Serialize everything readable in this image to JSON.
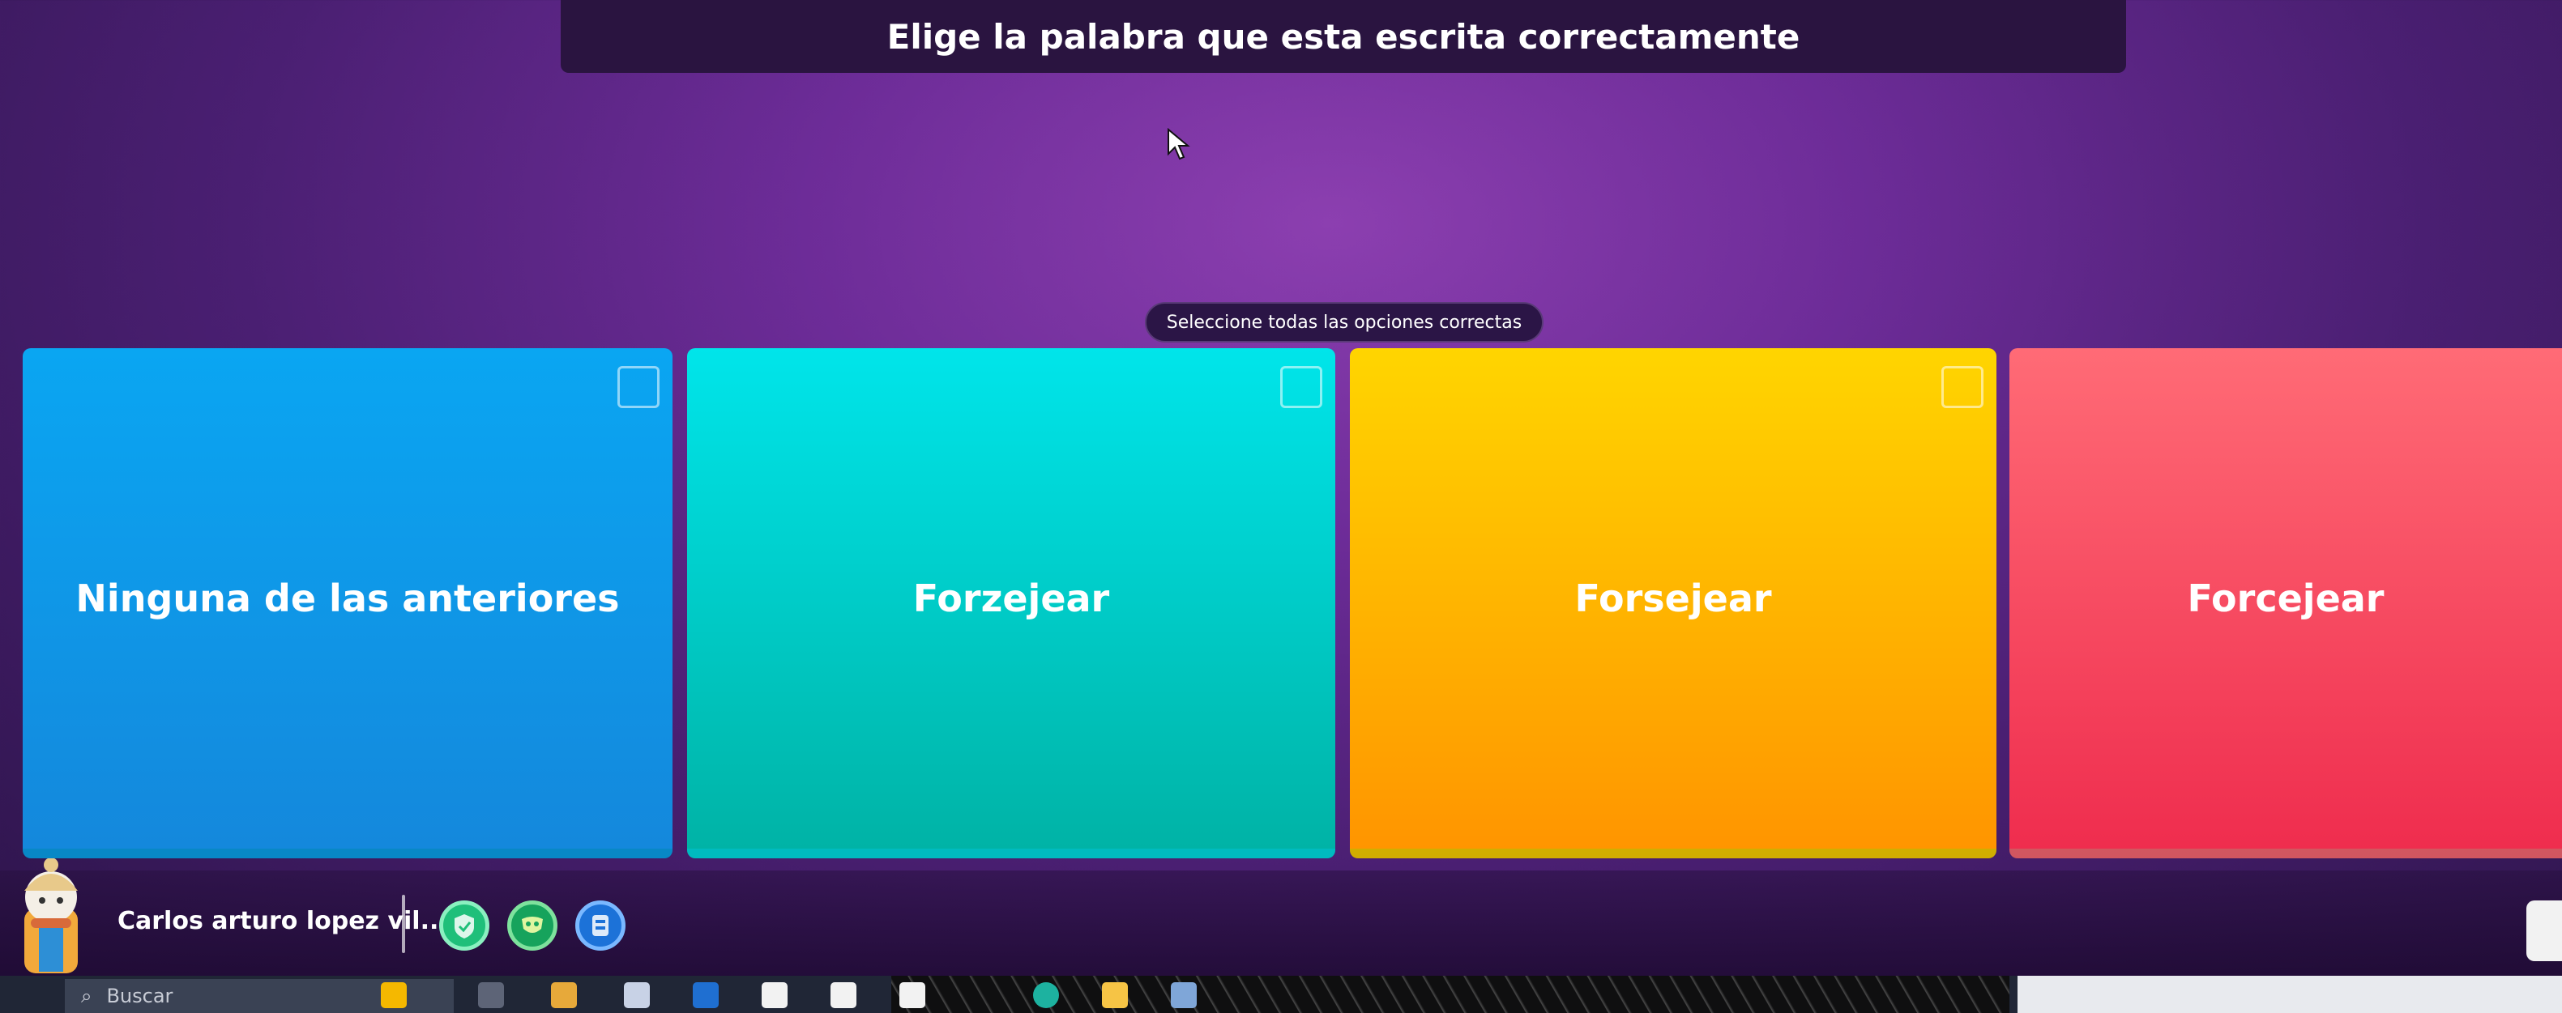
{
  "question": {
    "text": "Elige la palabra que esta escrita correctamente"
  },
  "instruction": {
    "text": "Seleccione todas las opciones correctas"
  },
  "options": [
    {
      "label": "Ninguna de las anteriores",
      "color": "#0aa6f2"
    },
    {
      "label": "Forzejear",
      "color": "#00c9c8"
    },
    {
      "label": "Forsejear",
      "color": "#ffb300"
    },
    {
      "label": "Forcejear",
      "color": "#f2475e"
    }
  ],
  "player": {
    "name": "Carlos arturo lopez vil...",
    "powerups": [
      "shield-powerup-icon",
      "mask-powerup-icon",
      "streak-powerup-icon"
    ]
  },
  "taskbar": {
    "search_placeholder": "Buscar",
    "search_icon": "⌕"
  }
}
